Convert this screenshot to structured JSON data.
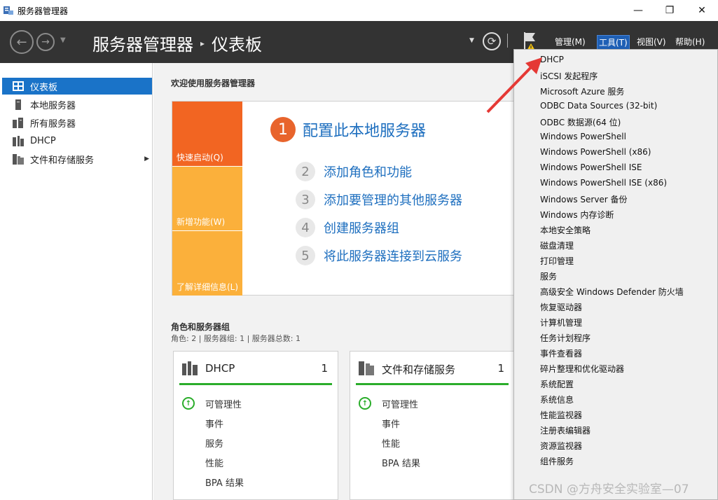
{
  "window": {
    "title": "服务器管理器",
    "icon": "server-manager-icon",
    "controls": {
      "minimize": "—",
      "maximize": "❐",
      "close": "✕"
    }
  },
  "header": {
    "breadcrumb_app": "服务器管理器",
    "breadcrumb_sep": "▸",
    "breadcrumb_page": "仪表板",
    "menus": [
      {
        "label": "管理(M)",
        "active": false
      },
      {
        "label": "工具(T)",
        "active": true
      },
      {
        "label": "视图(V)",
        "active": false
      },
      {
        "label": "帮助(H)",
        "active": false
      }
    ]
  },
  "sidebar": {
    "items": [
      {
        "label": "仪表板",
        "icon": "dashboard-icon",
        "selected": true
      },
      {
        "label": "本地服务器",
        "icon": "local-server-icon",
        "selected": false
      },
      {
        "label": "所有服务器",
        "icon": "all-servers-icon",
        "selected": false
      },
      {
        "label": "DHCP",
        "icon": "dhcp-icon",
        "selected": false
      },
      {
        "label": "文件和存储服务",
        "icon": "file-storage-icon",
        "selected": false,
        "has_arrow": true
      }
    ]
  },
  "main": {
    "welcome": "欢迎使用服务器管理器",
    "quick_start": {
      "tiles": [
        "快速启动(Q)",
        "新增功能(W)",
        "了解详细信息(L)"
      ],
      "step1": {
        "num": "1",
        "label": "配置此本地服务器"
      },
      "steps": [
        {
          "num": "2",
          "label": "添加角色和功能"
        },
        {
          "num": "3",
          "label": "添加要管理的其他服务器"
        },
        {
          "num": "4",
          "label": "创建服务器组"
        },
        {
          "num": "5",
          "label": "将此服务器连接到云服务"
        }
      ]
    },
    "roles_title": "角色和服务器组",
    "roles_sub": "角色: 2 | 服务器组: 1 | 服务器总数: 1",
    "cards": [
      {
        "title": "DHCP",
        "count": "1",
        "icon": "dhcp-icon",
        "rows": [
          "可管理性",
          "事件",
          "服务",
          "性能",
          "BPA 结果"
        ]
      },
      {
        "title": "文件和存储服务",
        "count": "1",
        "icon": "file-storage-icon",
        "rows": [
          "可管理性",
          "事件",
          "性能",
          "BPA 结果"
        ]
      }
    ]
  },
  "tools_menu": {
    "items": [
      "DHCP",
      "iSCSI 发起程序",
      "Microsoft Azure 服务",
      "ODBC Data Sources (32-bit)",
      "ODBC 数据源(64 位)",
      "Windows PowerShell",
      "Windows PowerShell (x86)",
      "Windows PowerShell ISE",
      "Windows PowerShell ISE (x86)",
      "Windows Server 备份",
      "Windows 内存诊断",
      "本地安全策略",
      "磁盘清理",
      "打印管理",
      "服务",
      "高级安全 Windows Defender 防火墙",
      "恢复驱动器",
      "计算机管理",
      "任务计划程序",
      "事件查看器",
      "碎片整理和优化驱动器",
      "系统配置",
      "系统信息",
      "性能监视器",
      "注册表编辑器",
      "资源监视器",
      "组件服务"
    ]
  },
  "watermark": "CSDN @方舟安全实验室—07",
  "colors": {
    "header_bg": "#333333",
    "accent_blue": "#1a73c8",
    "tile_orange_dark": "#f26522",
    "tile_orange_light": "#fbb03b",
    "status_green": "#2aad2a",
    "annotation_red": "#e53935"
  }
}
